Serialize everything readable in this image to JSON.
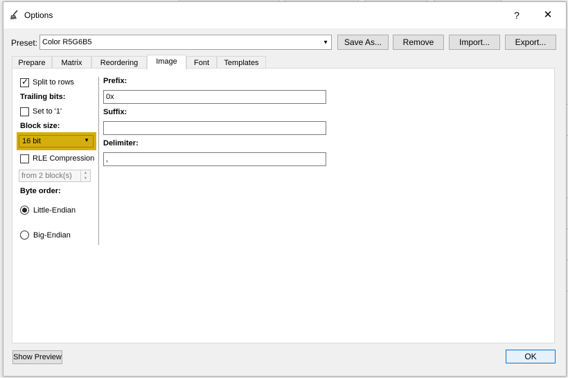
{
  "window": {
    "title": "Options"
  },
  "titlebar": {
    "help": "?",
    "close": "✕"
  },
  "preset": {
    "label": "Preset:",
    "selected": "Color R5G6B5",
    "buttons": {
      "save_as": "Save As...",
      "remove": "Remove",
      "import": "Import...",
      "export": "Export..."
    }
  },
  "tabs": [
    {
      "label": "Prepare"
    },
    {
      "label": "Matrix"
    },
    {
      "label": "Reordering"
    },
    {
      "label": "Image",
      "active": true
    },
    {
      "label": "Font"
    },
    {
      "label": "Templates"
    }
  ],
  "image_tab": {
    "split_to_rows": {
      "label": "Split to rows",
      "checked": true
    },
    "trailing_bits": {
      "heading": "Trailing bits:",
      "set_to_one": {
        "label": "Set to '1'",
        "checked": false
      }
    },
    "block_size": {
      "heading": "Block size:",
      "value": "16 bit"
    },
    "rle_compression": {
      "label": "RLE Compression",
      "checked": false,
      "from_blocks": "from 2 block(s)"
    },
    "byte_order": {
      "heading": "Byte order:",
      "little_endian": {
        "label": "Little-Endian",
        "selected": true
      },
      "big_endian": {
        "label": "Big-Endian",
        "selected": false
      }
    },
    "prefix": {
      "label": "Prefix:",
      "value": "0x"
    },
    "suffix": {
      "label": "Suffix:",
      "value": ""
    },
    "delimiter": {
      "label": "Delimiter:",
      "value": ","
    }
  },
  "footer": {
    "show_preview": "Show Preview",
    "ok": "OK"
  },
  "colors": {
    "highlight": "#d4af0c",
    "ok_border": "#0078d7"
  }
}
